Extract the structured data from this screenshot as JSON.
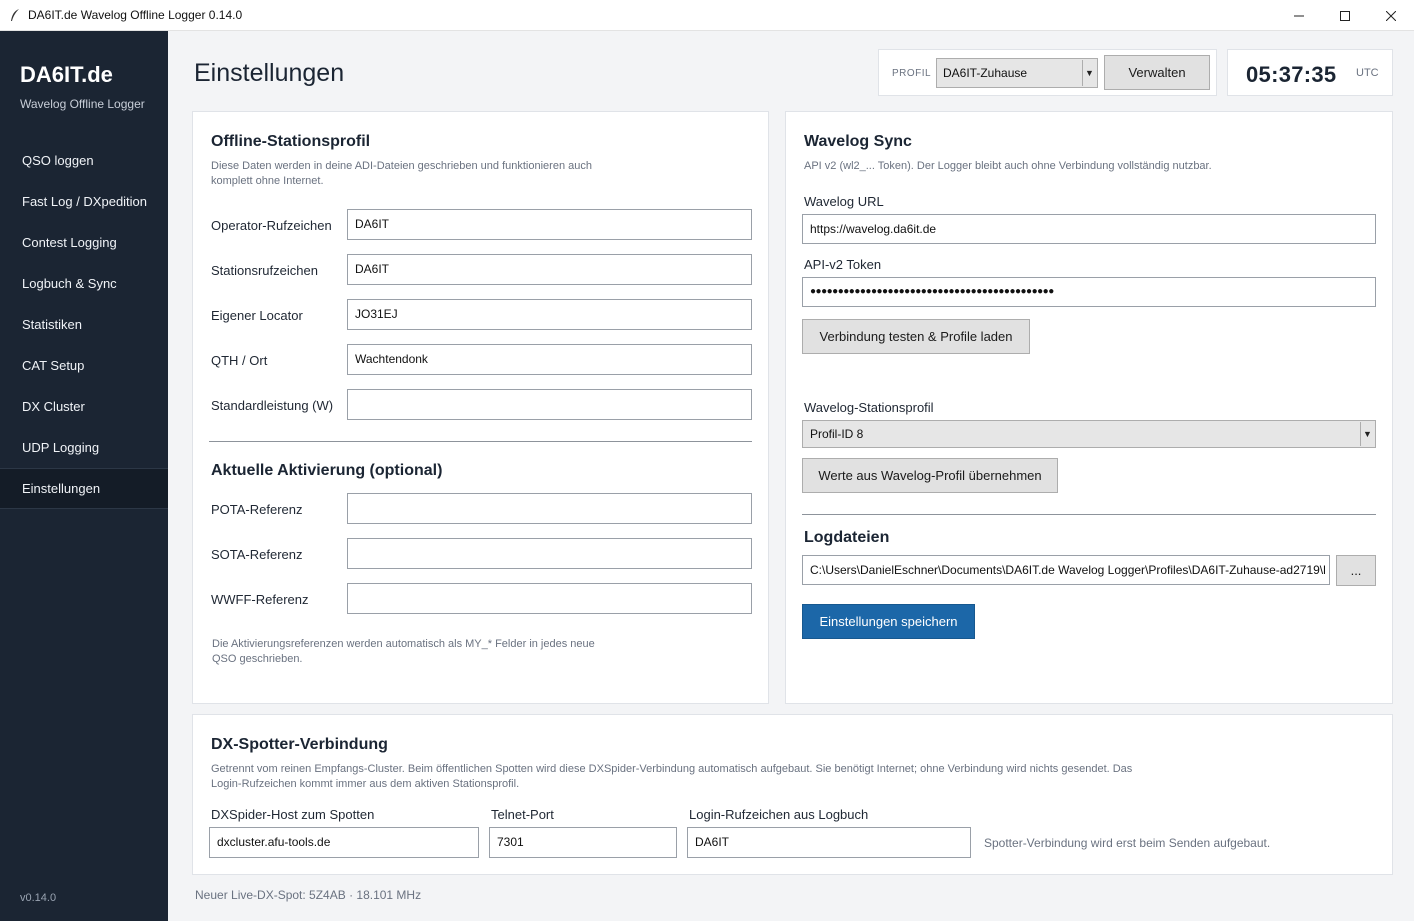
{
  "window": {
    "title": "DA6IT.de Wavelog Offline Logger 0.14.0",
    "icon": "feather-icon",
    "minimize": "—",
    "maximize": "☐",
    "close": "✕"
  },
  "sidebar": {
    "brand": "DA6IT.de",
    "subtitle": "Wavelog Offline Logger",
    "items": [
      {
        "label": "QSO loggen"
      },
      {
        "label": "Fast Log / DXpedition"
      },
      {
        "label": "Contest Logging"
      },
      {
        "label": "Logbuch & Sync"
      },
      {
        "label": "Statistiken"
      },
      {
        "label": "CAT Setup"
      },
      {
        "label": "DX Cluster"
      },
      {
        "label": "UDP Logging"
      },
      {
        "label": "Einstellungen",
        "active": true
      }
    ],
    "version": "v0.14.0"
  },
  "header": {
    "title": "Einstellungen",
    "profile_label": "PROFIL",
    "profile_value": "DA6IT-Zuhause",
    "manage_label": "Verwalten",
    "clock_time": "05:37:35",
    "clock_tz": "UTC"
  },
  "offline_profile": {
    "title": "Offline-Stationsprofil",
    "hint_line1": "Diese Daten werden in deine ADI-Dateien geschrieben und funktionieren auch",
    "hint_line2": "komplett ohne Internet.",
    "fields": [
      {
        "label": "Operator-Rufzeichen",
        "value": "DA6IT"
      },
      {
        "label": "Stationsrufzeichen",
        "value": "DA6IT"
      },
      {
        "label": "Eigener Locator",
        "value": "JO31EJ"
      },
      {
        "label": "QTH / Ort",
        "value": "Wachtendonk"
      },
      {
        "label": "Standardleistung (W)",
        "value": ""
      }
    ],
    "activation_title": "Aktuelle Aktivierung (optional)",
    "activation_fields": [
      {
        "label": "POTA-Referenz",
        "value": ""
      },
      {
        "label": "SOTA-Referenz",
        "value": ""
      },
      {
        "label": "WWFF-Referenz",
        "value": ""
      }
    ],
    "activation_hint_line1": "Die Aktivierungsreferenzen werden automatisch als MY_* Felder in jedes neue",
    "activation_hint_line2": "QSO geschrieben."
  },
  "wavelog_sync": {
    "title": "Wavelog Sync",
    "hint": "API v2 (wl2_... Token). Der Logger bleibt auch ohne Verbindung vollständig nutzbar.",
    "url_label": "Wavelog URL",
    "url_value": "https://wavelog.da6it.de",
    "token_label": "API-v2 Token",
    "token_value": "●●●●●●●●●●●●●●●●●●●●●●●●●●●●●●●●●●●●●●●●●●●●",
    "test_button": "Verbindung testen & Profile laden",
    "station_profile_label": "Wavelog-Stationsprofil",
    "station_profile_value": "Profil-ID 8",
    "apply_button": "Werte aus Wavelog-Profil übernehmen",
    "logfiles_title": "Logdateien",
    "logfile_path": "C:\\Users\\DanielEschner\\Documents\\DA6IT.de Wavelog Logger\\Profiles\\DA6IT-Zuhause-ad2719\\l",
    "browse_button": "...",
    "save_button": "Einstellungen speichern"
  },
  "dx_spotter": {
    "title": "DX-Spotter-Verbindung",
    "hint_line1": "Getrennt vom reinen Empfangs-Cluster. Beim öffentlichen Spotten wird diese DXSpider-Verbindung automatisch aufgebaut. Sie benötigt Internet; ohne Verbindung wird nichts gesendet. Das",
    "hint_line2": "Login-Rufzeichen kommt immer aus dem aktiven Stationsprofil.",
    "host_label": "DXSpider-Host zum Spotten",
    "host_value": "dxcluster.afu-tools.de",
    "port_label": "Telnet-Port",
    "port_value": "7301",
    "login_label": "Login-Rufzeichen aus Logbuch",
    "login_value": "DA6IT",
    "status_text": "Spotter-Verbindung wird erst beim Senden aufgebaut."
  },
  "status_bar": {
    "text": "Neuer Live-DX-Spot: 5Z4AB · 18.101 MHz"
  },
  "colors": {
    "sidebar_bg": "#1b2533",
    "primary": "#1c67a8",
    "page_bg": "#f3f4f6"
  }
}
